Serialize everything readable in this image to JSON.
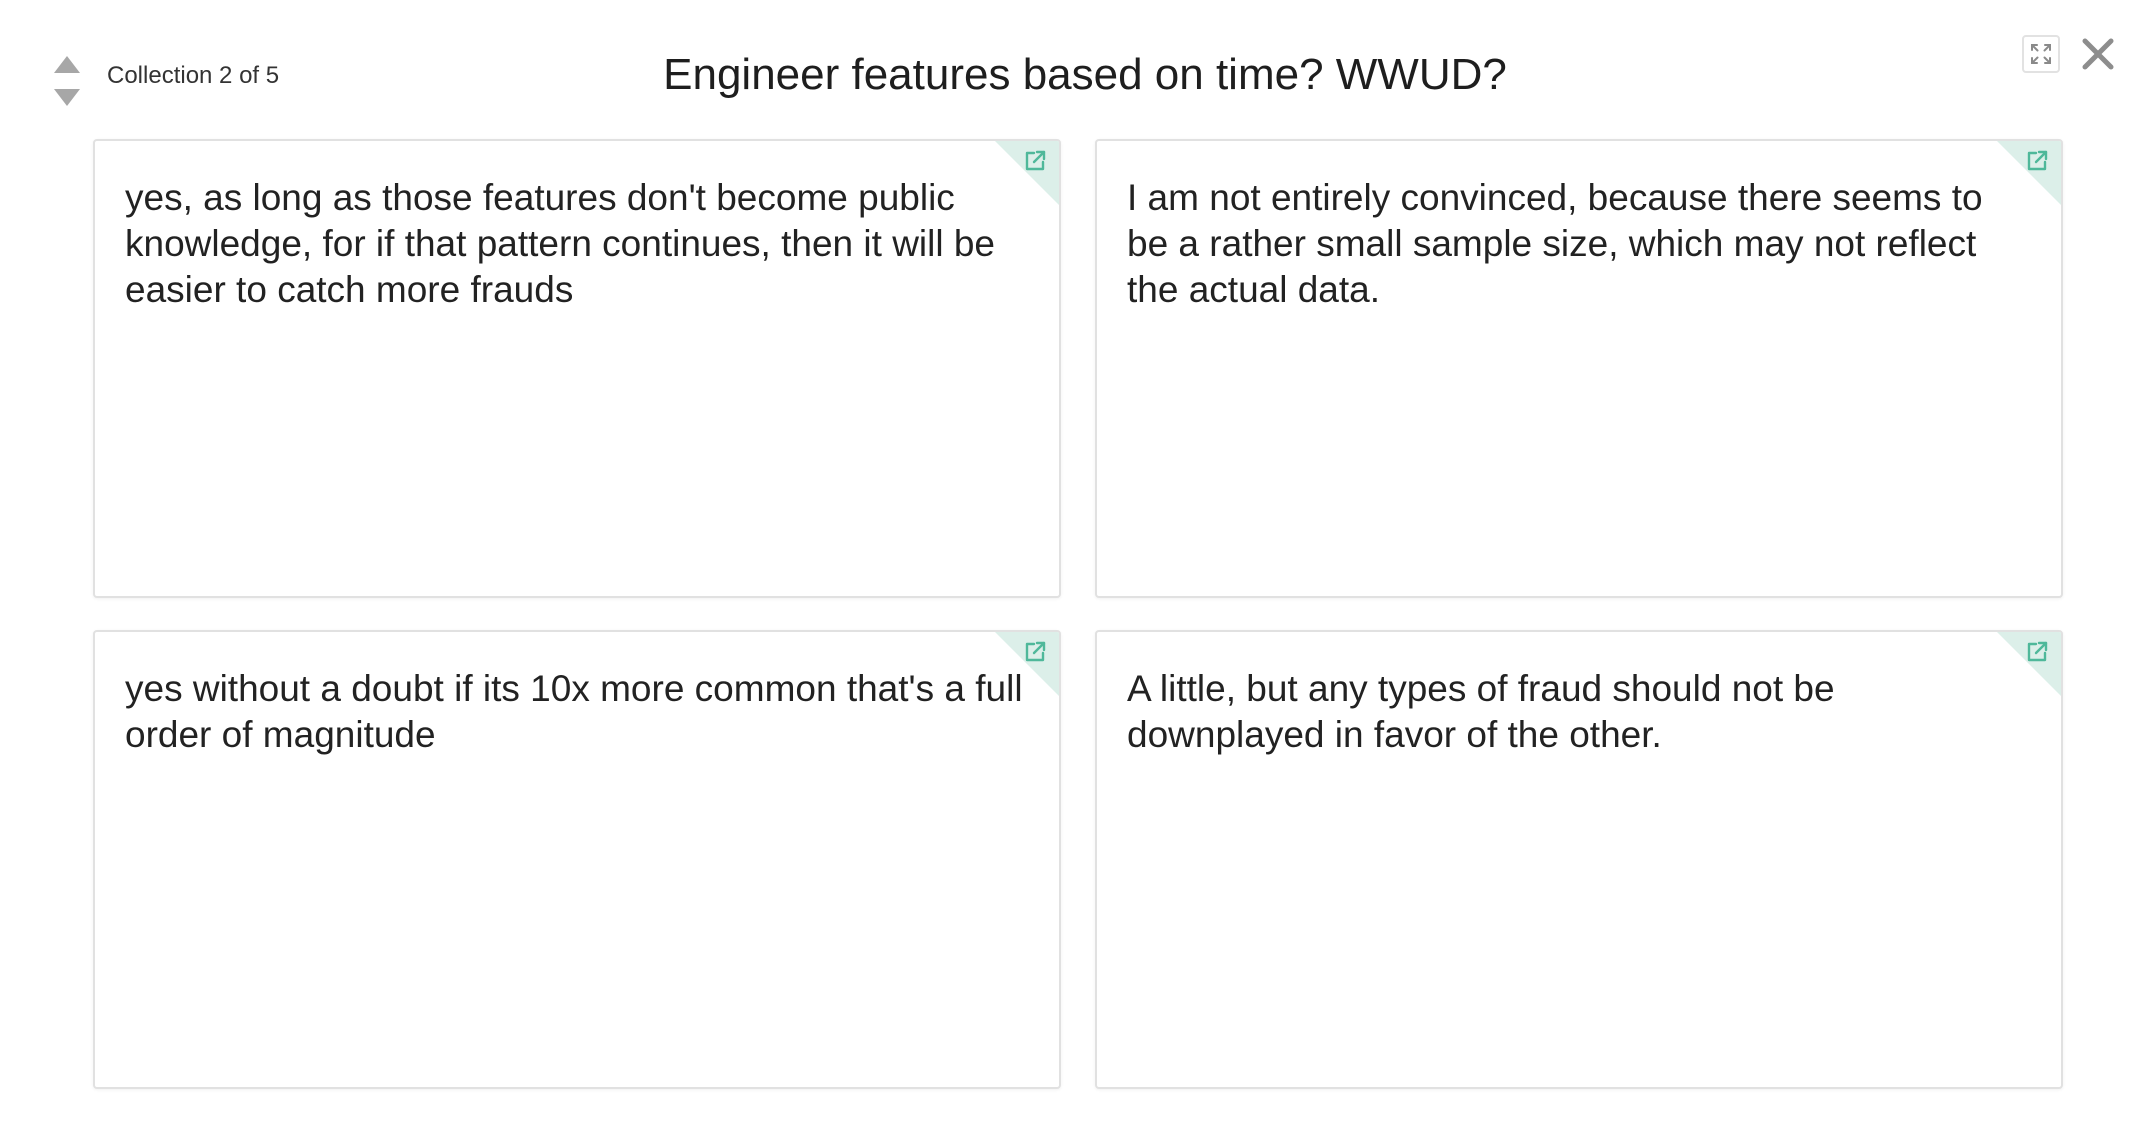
{
  "header": {
    "collection_label": "Collection 2 of 5",
    "title": "Engineer features based on time? WWUD?"
  },
  "icons": {
    "prev": "caret-up-icon",
    "next": "caret-down-icon",
    "expand": "expand-icon",
    "close": "close-icon",
    "open_card": "open-external-icon"
  },
  "colors": {
    "accent": "#4fb89a",
    "card_corner": "#dcefe9",
    "card_border": "#e1e1e1",
    "arrow": "#a7a7a7"
  },
  "cards": [
    {
      "text": "yes, as long as those features don't become public knowledge, for if that pattern continues, then it will be easier to catch more frauds"
    },
    {
      "text": "I am not entirely convinced, because there seems to be a rather small sample size, which may not reflect the actual data."
    },
    {
      "text": "yes without a doubt if its 10x more common that's a full order of magnitude"
    },
    {
      "text": "A little, but any types of fraud should not be downplayed in favor of the other."
    }
  ]
}
